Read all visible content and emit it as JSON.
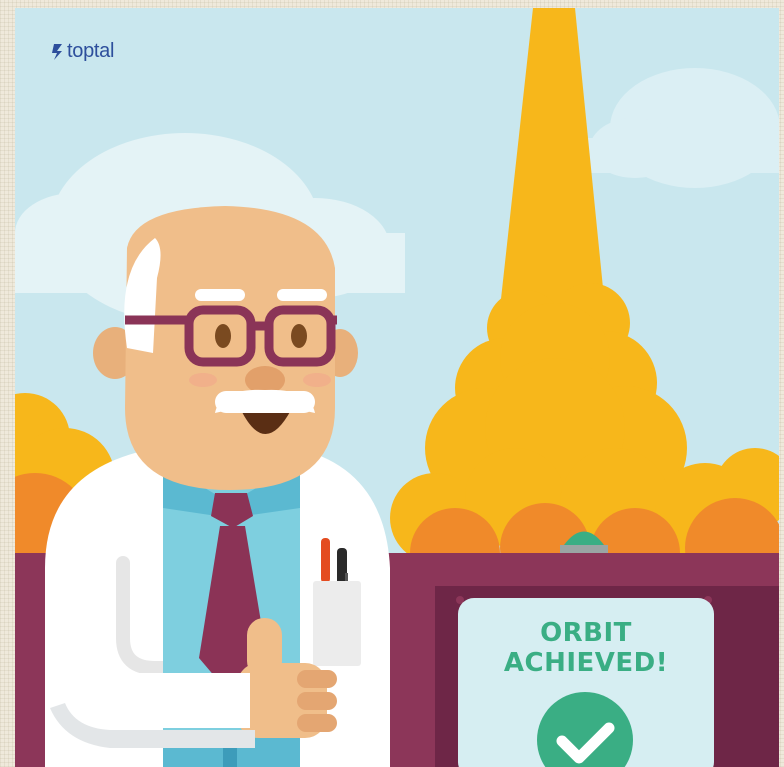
{
  "brand": {
    "name": "toptal",
    "color": "#2d4f9c"
  },
  "screen": {
    "line1": "ORBIT",
    "line2": "ACHIEVED!",
    "text_color": "#3aae84"
  },
  "icons": [
    "toptal-logo-icon",
    "checkmark-icon",
    "launch-button-icon"
  ],
  "colors": {
    "sky": "#c9e7ee",
    "rocket_flame": "#f7b71b",
    "smoke_orange": "#f08a2a",
    "console": "#8c3659",
    "lab_coat": "#ffffff",
    "shirt": "#7ecfdf",
    "tie": "#8b3356",
    "skin": "#f0be8a",
    "glasses": "#8a3457"
  }
}
